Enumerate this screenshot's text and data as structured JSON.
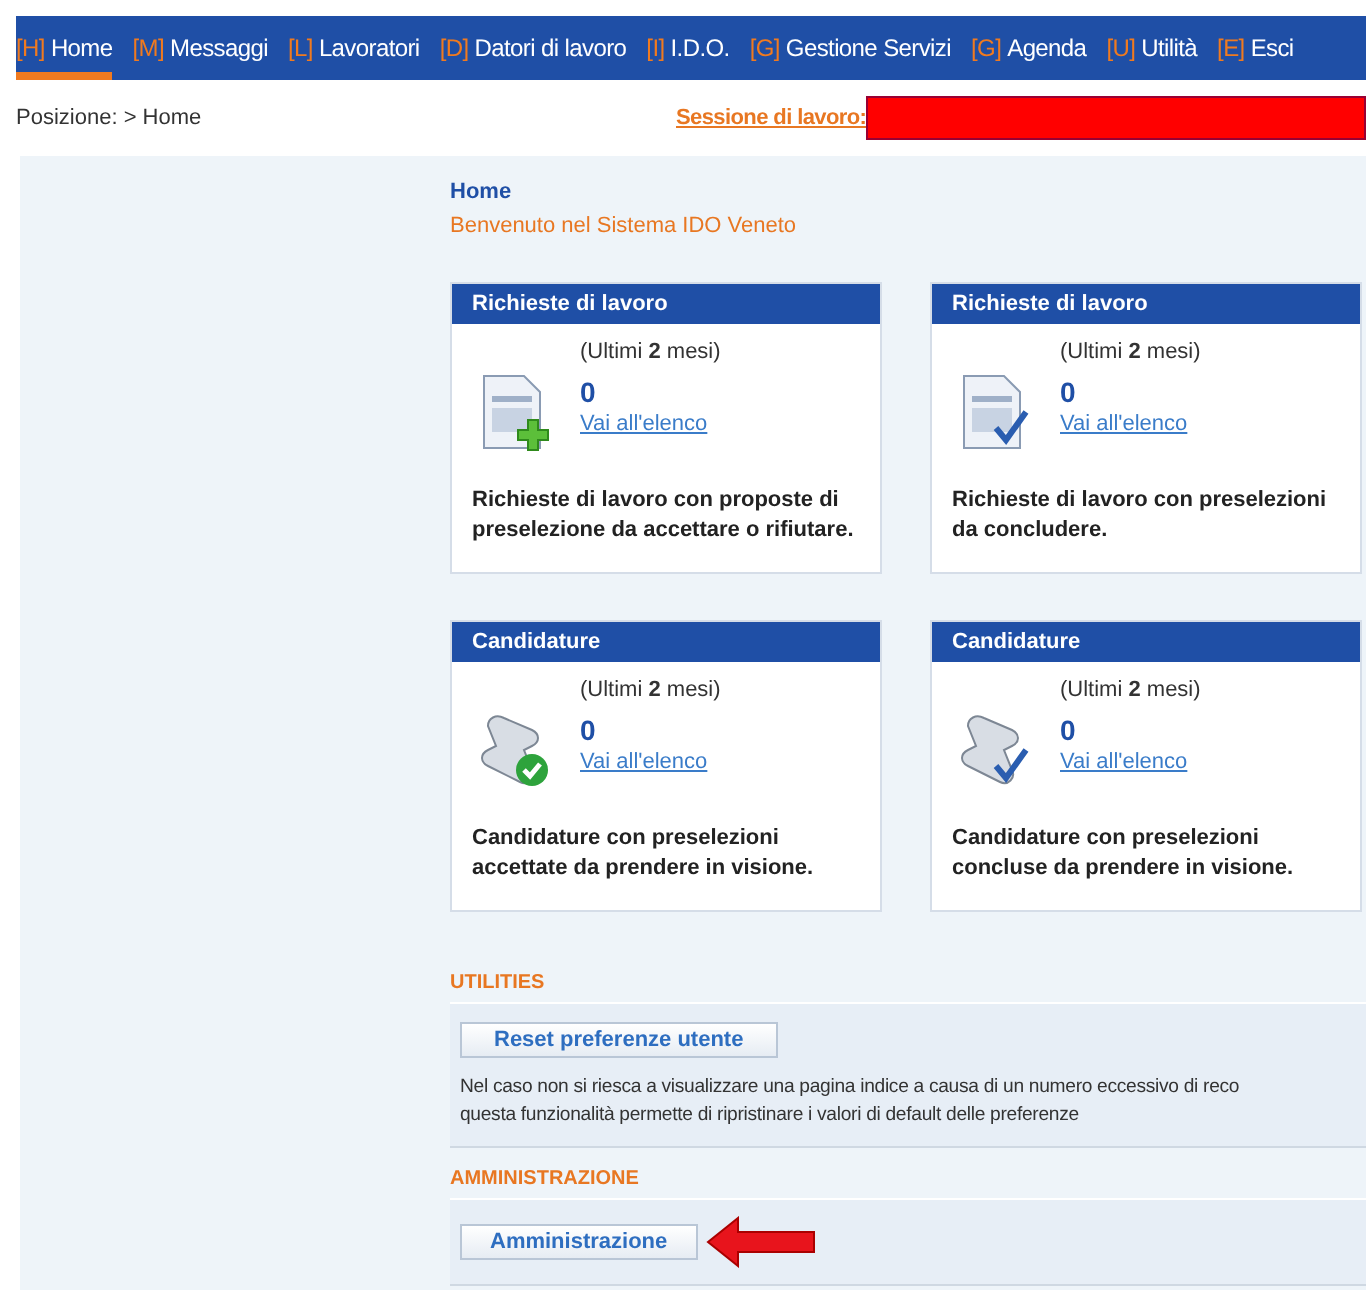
{
  "nav": [
    {
      "key": "[H]",
      "label": "Home",
      "selected": true
    },
    {
      "key": "[M]",
      "label": "Messaggi",
      "selected": false
    },
    {
      "key": "[L]",
      "label": "Lavoratori",
      "selected": false
    },
    {
      "key": "[D]",
      "label": "Datori di lavoro",
      "selected": false
    },
    {
      "key": "[I]",
      "label": "I.D.O.",
      "selected": false
    },
    {
      "key": "[G]",
      "label": "Gestione Servizi",
      "selected": false
    },
    {
      "key": "[G]",
      "label": "Agenda",
      "selected": false
    },
    {
      "key": "[U]",
      "label": "Utilità",
      "selected": false
    },
    {
      "key": "[E]",
      "label": "Esci",
      "selected": false
    }
  ],
  "breadcrumb": {
    "label": "Posizione:",
    "path": "> Home"
  },
  "session": {
    "label": "Sessione di lavoro:"
  },
  "page_title": "Home",
  "welcome": "Benvenuto nel Sistema IDO Veneto",
  "cards": [
    {
      "title": "Richieste di lavoro",
      "kind": "doc-plus",
      "period": "(Ultimi **2** mesi)",
      "count": "0",
      "link": "Vai all'elenco",
      "description": "Richieste di lavoro con proposte di preselezione da accettare o rifiutare."
    },
    {
      "title": "Richieste di lavoro",
      "kind": "doc-check",
      "period": "(Ultimi **2** mesi)",
      "count": "0",
      "link": "Vai all'elenco",
      "description": "Richieste di lavoro con preselezioni da concludere."
    },
    {
      "title": "Candidature",
      "kind": "scroll-ok",
      "period": "(Ultimi **2** mesi)",
      "count": "0",
      "link": "Vai all'elenco",
      "description": "Candidature con preselezioni accettate da prendere in visione."
    },
    {
      "title": "Candidature",
      "kind": "scroll-check",
      "period": "(Ultimi **2** mesi)",
      "count": "0",
      "link": "Vai all'elenco",
      "description": "Candidature con preselezioni concluse da prendere in visione."
    }
  ],
  "utilities": {
    "heading": "UTILITIES",
    "button": "Reset preferenze utente",
    "lines": [
      "Nel caso non si riesca a visualizzare una pagina indice a causa di un numero eccessivo di reco",
      "questa funzionalità permette di ripristinare i valori di default delle preferenze"
    ]
  },
  "admin": {
    "heading": "AMMINISTRAZIONE",
    "button": "Amministrazione"
  }
}
